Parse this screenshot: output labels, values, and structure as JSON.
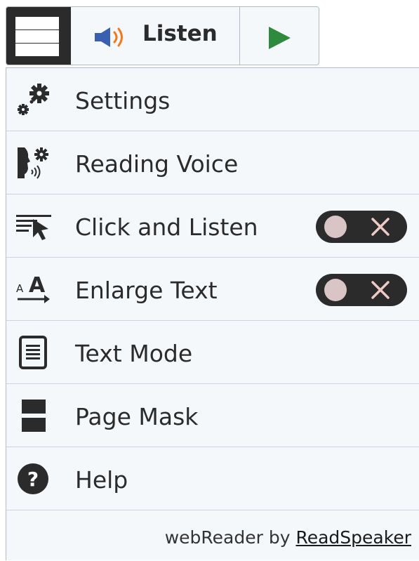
{
  "toolbar": {
    "listen_label": "Listen",
    "icons": {
      "menu": "menu-icon",
      "speaker": "speaker-icon",
      "play": "play-icon"
    },
    "colors": {
      "speaker_orange": "#f07a1c",
      "speaker_blue": "#3a5fb0",
      "play_green": "#2e8b3d"
    }
  },
  "menu": {
    "items": [
      {
        "label": "Settings",
        "icon": "gear-icon"
      },
      {
        "label": "Reading Voice",
        "icon": "voice-settings-icon"
      },
      {
        "label": "Click and Listen",
        "icon": "click-listen-icon",
        "toggle": "off"
      },
      {
        "label": "Enlarge Text",
        "icon": "enlarge-text-icon",
        "toggle": "off"
      },
      {
        "label": "Text Mode",
        "icon": "text-mode-icon"
      },
      {
        "label": "Page Mask",
        "icon": "page-mask-icon"
      },
      {
        "label": "Help",
        "icon": "help-icon"
      }
    ]
  },
  "footer": {
    "prefix": "webReader by",
    "link": "ReadSpeaker"
  }
}
